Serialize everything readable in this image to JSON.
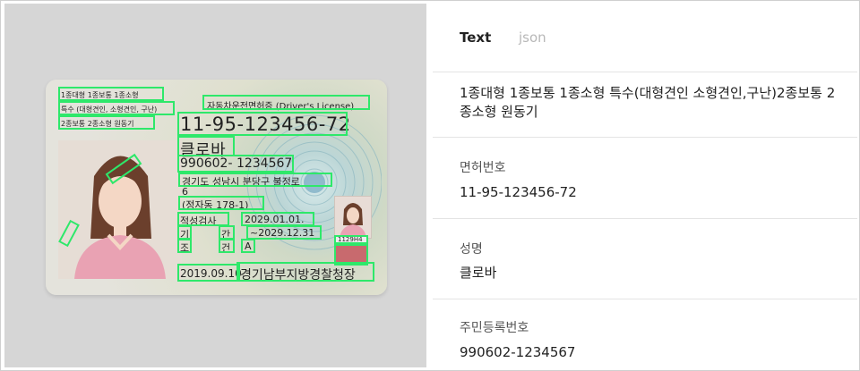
{
  "tabs": {
    "text_label": "Text",
    "json_label": "json"
  },
  "card": {
    "types_line1": "1종대형 1종보통 1종소형",
    "types_line2": "특수 (대형견인, 소형견인, 구난)",
    "types_line3": "2종보통 2종소형 원동기",
    "title": "자동차운전면허증 (Driver's License)",
    "license_number": "11-95-123456-72",
    "name": "클로바",
    "rrn": "990602- 1234567",
    "address_line1": "경기도 성남시 분당구 불정로",
    "address_line2": "6",
    "address_line3": "(정자동 178-1)",
    "aptitude_label": "적성검사",
    "aptitude_date": "2029.01.01.",
    "period_label_1": "기",
    "period_label_2": "간",
    "period_value": "~2029.12.31",
    "condition_label_1": "조",
    "condition_label_2": "건",
    "condition_value": "A",
    "issue_date": "2019.09.10.",
    "issuer": "경기남부지방경찰청장",
    "small_code": "1129H4"
  },
  "fields": [
    {
      "label": "",
      "value": "1종대형 1종보통 1종소형 특수(대형견인 소형견인,구난)2종보통 2종소형 원동기"
    },
    {
      "label": "면허번호",
      "value": "11-95-123456-72"
    },
    {
      "label": "성명",
      "value": "클로바"
    },
    {
      "label": "주민등록번호",
      "value": "990602-1234567"
    }
  ],
  "colors": {
    "highlight": "#2ee86a",
    "left_bg": "#d6d6d6",
    "tab_inactive": "#b8b8b8"
  }
}
